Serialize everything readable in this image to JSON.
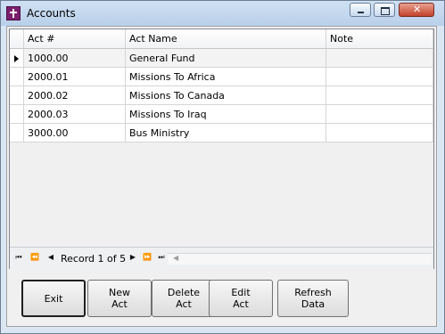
{
  "window": {
    "title": "Accounts"
  },
  "grid": {
    "columns": [
      "Act #",
      "Act Name",
      "Note"
    ],
    "rows": [
      {
        "act": "1000.00",
        "name": "General Fund",
        "note": ""
      },
      {
        "act": "2000.01",
        "name": "Missions To Africa",
        "note": ""
      },
      {
        "act": "2000.02",
        "name": "Missions To Canada",
        "note": ""
      },
      {
        "act": "2000.03",
        "name": "Missions To Iraq",
        "note": ""
      },
      {
        "act": "3000.00",
        "name": "Bus Ministry",
        "note": ""
      }
    ]
  },
  "navigator": {
    "record_text": "Record 1 of 5"
  },
  "buttons": {
    "exit": "Exit",
    "new_act": "New\nAct",
    "delete_act": "Delete\nAct",
    "edit_act": "Edit\nAct",
    "refresh_data": "Refresh\nData"
  }
}
